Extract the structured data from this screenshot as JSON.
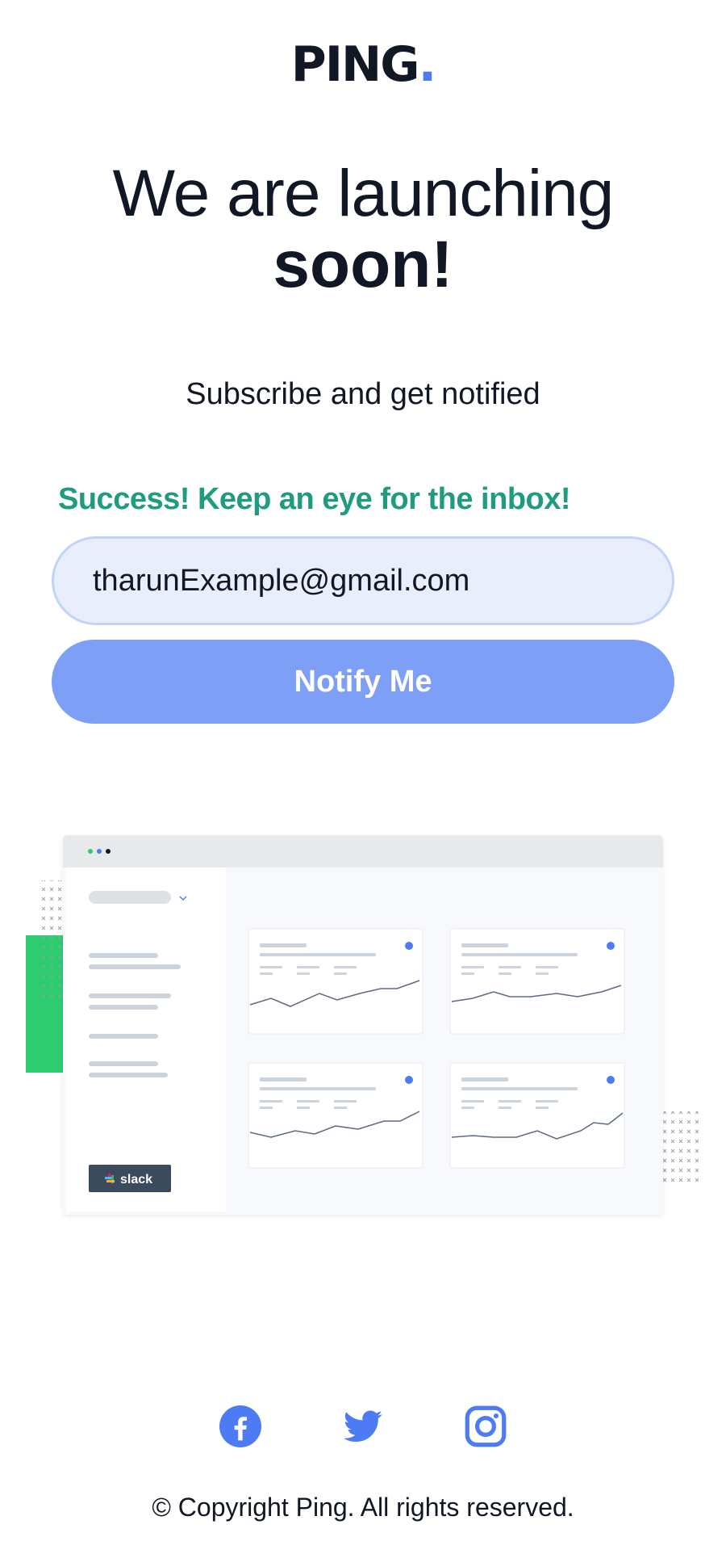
{
  "brand": {
    "name": "PING",
    "dot": "."
  },
  "hero": {
    "title_light": "We are launching",
    "title_bold": "soon!",
    "subtitle": "Subscribe and get notified"
  },
  "form": {
    "success_message": "Success! Keep an eye for the inbox!",
    "email_value": "tharunExample@gmail.com",
    "button_label": "Notify Me"
  },
  "dashboard": {
    "slack_label": "slack"
  },
  "social": {
    "icons": [
      "facebook-icon",
      "twitter-icon",
      "instagram-icon"
    ]
  },
  "footer": {
    "copyright": "© Copyright Ping. All rights reserved."
  },
  "colors": {
    "accent": "#4c7bf3",
    "button": "#7da0f6",
    "success": "#1f9b7f",
    "text": "#121725",
    "green_block": "#2ecc71"
  }
}
